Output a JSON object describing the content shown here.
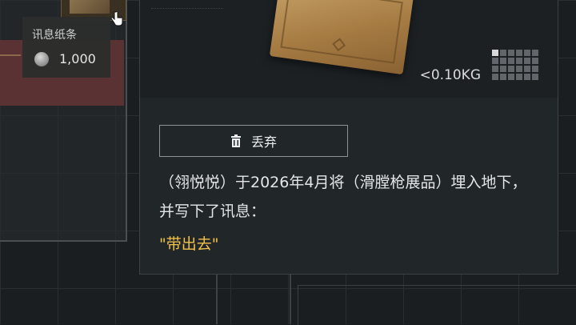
{
  "inventory_tooltip": {
    "item_name": "讯息纸条",
    "price": "1,000",
    "coin_icon": "silver-coin-icon"
  },
  "item_detail": {
    "weight": "<0.10KG",
    "weight_grid": {
      "filled": 1,
      "total": 24
    },
    "discard_label": "丢弃",
    "description": "（翎悦悦）于2026年4月将（滑膛枪展品）埋入地下，并写下了讯息：",
    "message": "\"带出去\""
  },
  "colors": {
    "accent_gold": "#f2c14a",
    "inventory_red": "#5a3233"
  }
}
